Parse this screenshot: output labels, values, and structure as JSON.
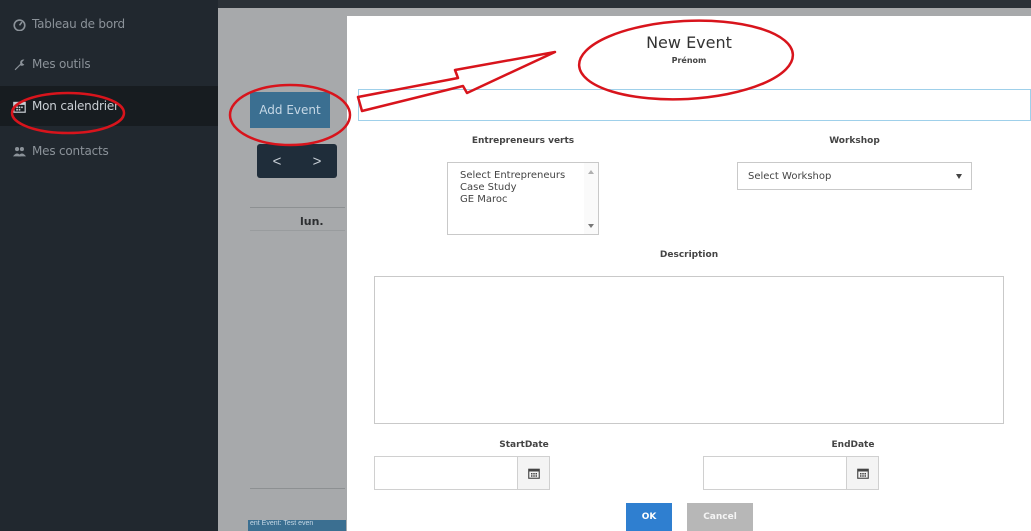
{
  "sidebar": {
    "items": [
      {
        "label": "Tableau de bord",
        "icon": "dashboard-icon"
      },
      {
        "label": "Mes outils",
        "icon": "wrench-icon"
      },
      {
        "label": "Mon calendrier",
        "icon": "calendar-icon"
      },
      {
        "label": "Mes contacts",
        "icon": "users-icon"
      }
    ]
  },
  "calendar": {
    "add_event_label": "Add Event",
    "prev": "<",
    "next": ">",
    "day_header": "lun.",
    "bottom_event": "ent Event: Test even"
  },
  "modal": {
    "title": "New Event",
    "prenom_label": "Prénom",
    "entrepreneurs_label": "Entrepreneurs verts",
    "entrepreneurs_options": [
      "Select Entrepreneurs",
      "Case Study",
      "GE Maroc"
    ],
    "workshop_label": "Workshop",
    "workshop_selected": "Select Workshop",
    "description_label": "Description",
    "start_label": "StartDate",
    "end_label": "EndDate",
    "ok_label": "OK",
    "cancel_label": "Cancel"
  },
  "colors": {
    "sidebar_bg": "#21282f",
    "accent_blue": "#2f7fd0",
    "tab_blue": "#3b6f91",
    "annotation_red": "#d8141c"
  }
}
